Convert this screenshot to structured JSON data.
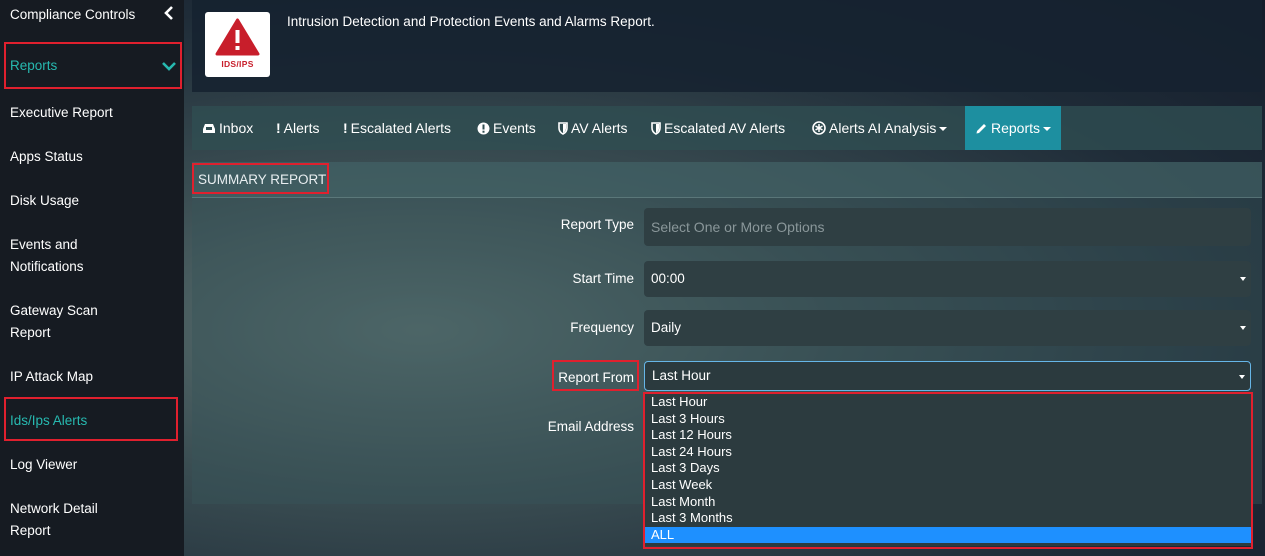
{
  "sidebar": {
    "items": [
      {
        "label": "Compliance Controls"
      },
      {
        "label": "Reports"
      },
      {
        "label": "Executive Report"
      },
      {
        "label": "Apps Status"
      },
      {
        "label": "Disk Usage"
      },
      {
        "label": "Events and Notifications"
      },
      {
        "label": "Gateway Scan Report"
      },
      {
        "label": "IP Attack Map"
      },
      {
        "label": "Ids/Ips Alerts"
      },
      {
        "label": "Log Viewer"
      },
      {
        "label": "Network Detail Report"
      }
    ]
  },
  "header": {
    "logo_text": "IDS/IPS",
    "description": "Intrusion Detection and Protection Events and Alarms Report."
  },
  "tabs": [
    {
      "label": "Inbox",
      "icon": "inbox-icon"
    },
    {
      "label": "Alerts",
      "icon": "exclamation-icon"
    },
    {
      "label": "Escalated Alerts",
      "icon": "exclamation-icon"
    },
    {
      "label": "Events",
      "icon": "exclamation-circle-icon"
    },
    {
      "label": "AV Alerts",
      "icon": "shield-icon"
    },
    {
      "label": "Escalated AV Alerts",
      "icon": "shield-icon"
    },
    {
      "label": "Alerts AI Analysis",
      "icon": "asterisk-icon"
    },
    {
      "label": "Reports",
      "icon": "pencil-icon"
    }
  ],
  "panel": {
    "title": "SUMMARY REPORT",
    "report_type_label": "Report Type",
    "report_type_placeholder": "Select One or More Options",
    "start_time_label": "Start Time",
    "start_time_value": "00:00",
    "frequency_label": "Frequency",
    "frequency_value": "Daily",
    "report_from_label": "Report From",
    "report_from_value": "Last Hour",
    "email_label": "Email Address",
    "report_from_options": [
      "Last Hour",
      "Last 3 Hours",
      "Last 12 Hours",
      "Last 24 Hours",
      "Last 3 Days",
      "Last Week",
      "Last Month",
      "Last 3 Months",
      "ALL"
    ]
  },
  "colors": {
    "accent_teal": "#27b9b0",
    "active_tab": "#1d8fa0",
    "highlight_red": "#e0202e",
    "selected_option": "#1e90ff"
  }
}
